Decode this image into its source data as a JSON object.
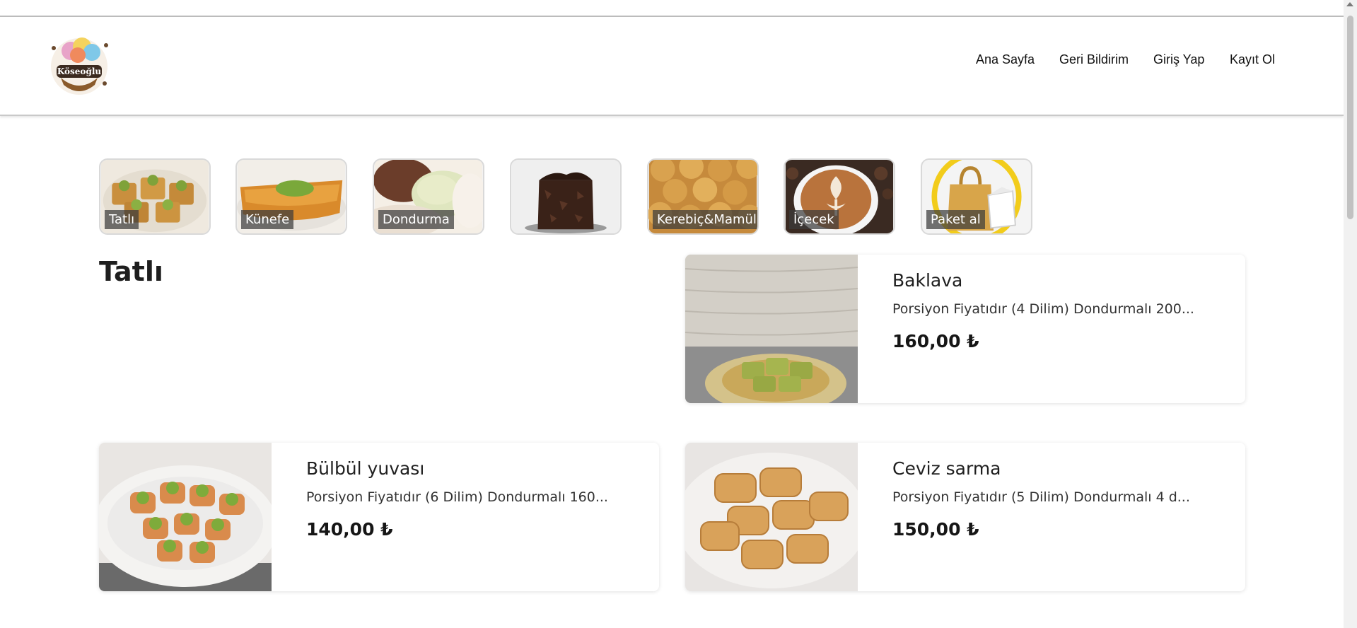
{
  "header": {
    "logo_text": "Köseoğlu",
    "nav": {
      "home": "Ana Sayfa",
      "feedback": "Geri Bildirim",
      "login": "Giriş Yap",
      "register": "Kayıt Ol"
    }
  },
  "categories": [
    {
      "label": "Tatlı",
      "icon": "baklava-thumbnail"
    },
    {
      "label": "Künefe",
      "icon": "kunefe-thumbnail"
    },
    {
      "label": "Dondurma",
      "icon": "ice-cream-thumbnail"
    },
    {
      "label": "",
      "icon": "chocolate-cake-thumbnail"
    },
    {
      "label": "Kerebiç&Mamül",
      "icon": "pastry-thumbnail"
    },
    {
      "label": "İçecek",
      "icon": "coffee-thumbnail"
    },
    {
      "label": "Paket al",
      "icon": "takeaway-bag-thumbnail"
    }
  ],
  "section": {
    "title": "Tatlı"
  },
  "products": [
    {
      "name": "Baklava",
      "description": "Porsiyon Fiyatıdır (4 Dilim) Dondurmalı 200...",
      "price": "160,00 ₺"
    },
    {
      "name": "Bülbül yuvası",
      "description": "Porsiyon Fiyatıdır (6 Dilim) Dondurmalı 160...",
      "price": "140,00 ₺"
    },
    {
      "name": "Ceviz sarma",
      "description": "Porsiyon Fiyatıdır (5 Dilim) Dondurmalı 4 d...",
      "price": "150,00 ₺"
    }
  ]
}
